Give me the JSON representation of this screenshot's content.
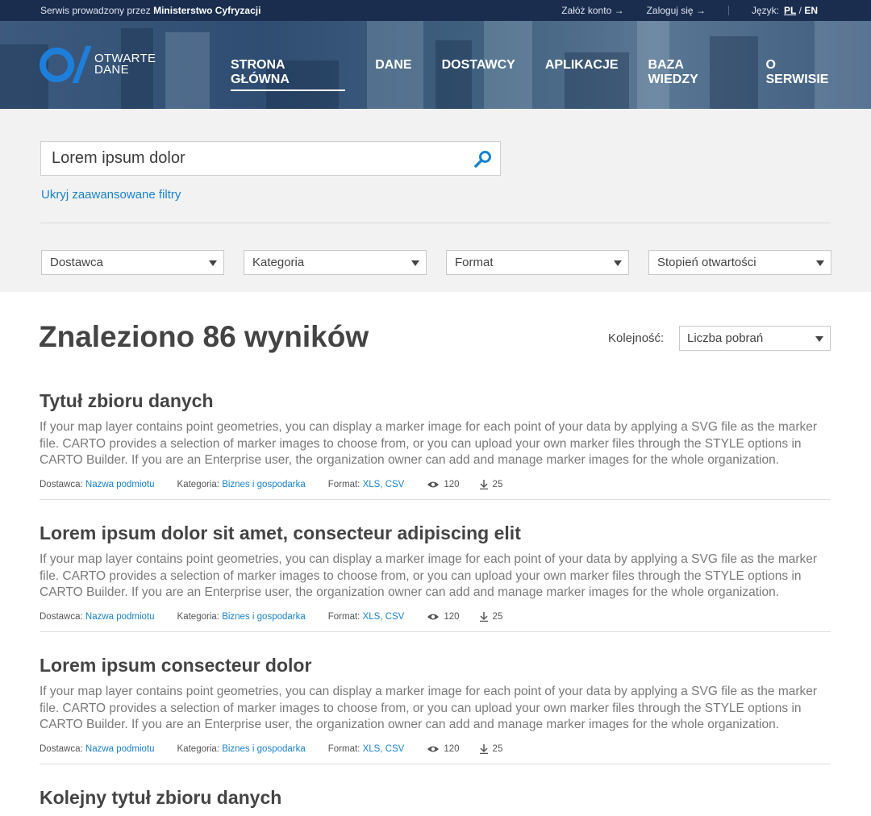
{
  "topbar": {
    "service_prefix": "Serwis prowadzony przez",
    "ministry": "Ministerstwo Cyfryzacji",
    "register": "Załóż konto →",
    "login": "Zaloguj się →",
    "lang_label": "Język:",
    "lang_pl": "PL",
    "lang_sep": " / ",
    "lang_en": "EN"
  },
  "logo": {
    "line1": "OTWARTE",
    "line2": "DANE"
  },
  "nav": [
    {
      "label": "STRONA GŁÓWNA",
      "active": true
    },
    {
      "label": "DANE"
    },
    {
      "label": "DOSTAWCY"
    },
    {
      "label": "APLIKACJE"
    },
    {
      "label": "BAZA WIEDZY"
    },
    {
      "label": "O SERWISIE"
    }
  ],
  "search": {
    "value": "Lorem ipsum dolor",
    "icon": "search-icon"
  },
  "advanced_filters_link": "Ukryj zaawansowane filtry",
  "filters": [
    "Dostawca",
    "Kategoria",
    "Format",
    "Stopień otwartości"
  ],
  "results": {
    "heading": "Znaleziono 86 wyników",
    "order_label": "Kolejność:",
    "order_value": "Liczba pobrań"
  },
  "items": [
    {
      "title": "Tytuł zbioru danych",
      "desc": "If your map layer contains point geometries, you can display a marker image for each point of your data by applying a SVG file as the marker file. CARTO provides a selection of marker images to choose from, or you can upload your own marker files through the STYLE options in CARTO Builder. If you are an Enterprise user, the organization owner can add and manage marker images for the whole organization.",
      "provider_label": "Dostawca:",
      "provider": "Nazwa podmiotu",
      "category_label": "Kategoria:",
      "category": "Biznes i gospodarka",
      "format_label": "Format:",
      "format": "XLS, CSV",
      "views": "120",
      "downloads": "25"
    },
    {
      "title": "Lorem ipsum dolor sit amet, consecteur adipiscing elit",
      "desc": "If your map layer contains point geometries, you can display a marker image for each point of your data by applying a SVG file as the marker file. CARTO provides a selection of marker images to choose from, or you can upload your own marker files through the STYLE options in CARTO Builder. If you are an Enterprise user, the organization owner can add and manage marker images for the whole organization.",
      "provider_label": "Dostawca:",
      "provider": "Nazwa podmiotu",
      "category_label": "Kategoria:",
      "category": "Biznes i gospodarka",
      "format_label": "Format:",
      "format": "XLS, CSV",
      "views": "120",
      "downloads": "25"
    },
    {
      "title": "Lorem ipsum consecteur dolor",
      "desc": "If your map layer contains point geometries, you can display a marker image for each point of your data by applying a SVG file as the marker file. CARTO provides a selection of marker images to choose from, or you can upload your own marker files through the STYLE options in CARTO Builder. If you are an Enterprise user, the organization owner can add and manage marker images for the whole organization.",
      "provider_label": "Dostawca:",
      "provider": "Nazwa podmiotu",
      "category_label": "Kategoria:",
      "category": "Biznes i gospodarka",
      "format_label": "Format:",
      "format": "XLS, CSV",
      "views": "120",
      "downloads": "25"
    },
    {
      "title": "Kolejny tytuł zbioru danych"
    }
  ],
  "colors": {
    "topbar": "#1a2d4f",
    "link": "#1a82cf",
    "logo": "#1e7fdb",
    "filters_bg": "#f2f2f2"
  }
}
